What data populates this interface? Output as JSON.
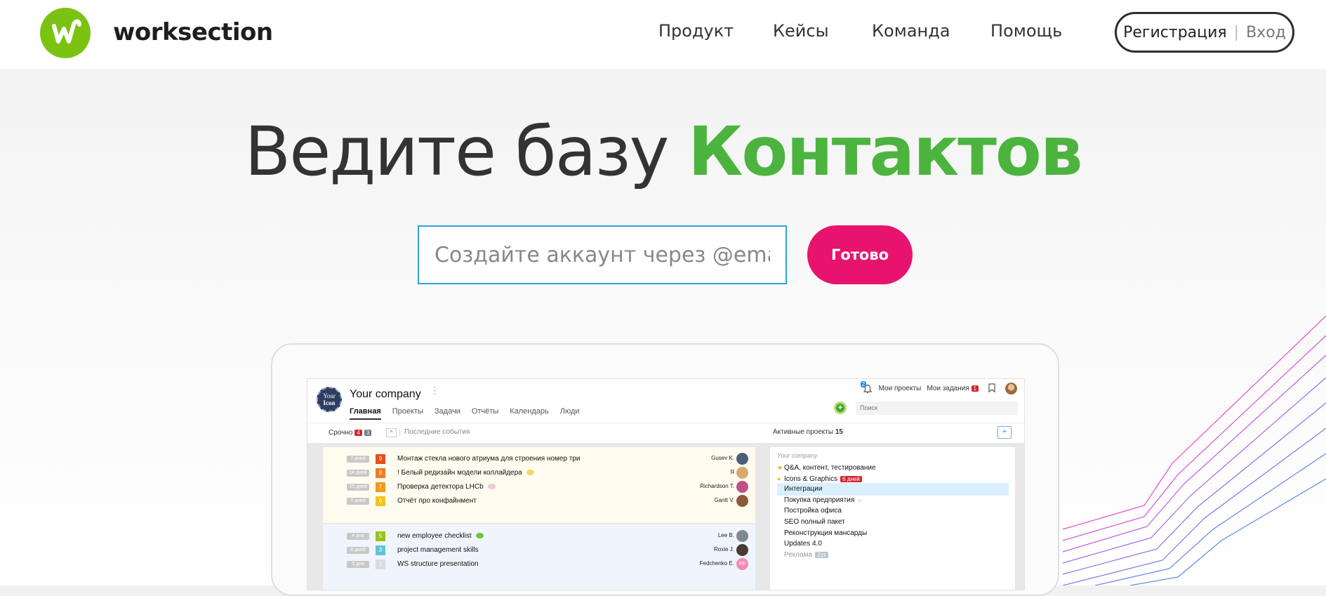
{
  "header": {
    "brand": "worksection",
    "nav": [
      "Продукт",
      "Кейсы",
      "Команда",
      "Помощь"
    ],
    "register": "Регистрация",
    "separator": "|",
    "login": "Вход"
  },
  "hero": {
    "title_plain": "Ведите базу",
    "title_accent": "Контактов",
    "email_placeholder": "Создайте аккаунт через @email",
    "submit_label": "Готово"
  },
  "colors": {
    "brand_green": "#7ac313",
    "accent_green": "#4cb43e",
    "cta_pink": "#e8136f",
    "input_border": "#2ea3d9"
  },
  "app": {
    "logo_text": [
      "Your",
      "Icon"
    ],
    "company": "Your company",
    "tabs": [
      "Главная",
      "Проекты",
      "Задачи",
      "Отчёты",
      "Календарь",
      "Люди"
    ],
    "notifications": "2",
    "my_projects": "Мои проекты",
    "my_tasks": "Мои задания",
    "my_tasks_count": "1",
    "search_placeholder": "Поиск",
    "urgent_label": "Срочно",
    "urgent_count_red": "4",
    "urgent_count_grey": "3",
    "collapse": "^",
    "last_events": "Последние события",
    "active_projects_label": "Активные проекты",
    "active_projects_count": "15",
    "add_project": "+",
    "tasks_urgent": [
      {
        "days": "7 дней",
        "prio": "9",
        "prio_color": "#e84e1b",
        "name": "Монтаж стекла нового атриума для строения номер три",
        "chat": "",
        "assignee": "Gusev K.",
        "avatar_color": "#4a6078"
      },
      {
        "days": "14 дней",
        "prio": "8",
        "prio_color": "#f07c1f",
        "name": "! Белый редизайн модели коллайдера",
        "chat": "#f6d562",
        "assignee": "Я",
        "avatar_color": "#d9a86c"
      },
      {
        "days": "15 дней",
        "prio": "7",
        "prio_color": "#f29a1c",
        "name": "Проверка детектора LHCb",
        "chat": "#f6c5d8",
        "assignee": "Richardson T.",
        "avatar_color": "#c24f8c"
      },
      {
        "days": "9 дней",
        "prio": "6",
        "prio_color": "#f7c21a",
        "name": "Отчёт про конфайнмент",
        "chat": "",
        "assignee": "Gantt V.",
        "avatar_color": "#8a5a3a"
      }
    ],
    "tasks_normal": [
      {
        "days": "4 дня",
        "prio": "5",
        "prio_color": "#98c21d",
        "name": "new employee checklist",
        "chat": "#6fc43d",
        "assignee": "Lee B.",
        "avatar_color": "#7e8a93"
      },
      {
        "days": "6 дней",
        "prio": "3",
        "prio_color": "#62c1d6",
        "name": "project management skills",
        "chat": "",
        "assignee": "Roxie J.",
        "avatar_color": "#4b3b36"
      },
      {
        "days": "3 дня",
        "prio": "1",
        "prio_color": "#d8dde2",
        "name": "WS structure presentation",
        "chat": "",
        "assignee": "Fedchenko E.",
        "avatar_color": "#f38bb4",
        "avatar_text": "FE"
      }
    ],
    "projects_heading": "Your company",
    "projects": [
      {
        "name": "Q&A, контент, тестирование",
        "marker": "★",
        "marker_color": "#f2a51d",
        "badge": "",
        "selected": false
      },
      {
        "name": "Icons & Graphics",
        "marker": "●",
        "marker_color": "#f2c01d",
        "badge": "6 дней",
        "selected": false
      },
      {
        "name": "Интеграции",
        "marker": "",
        "marker_color": "",
        "badge": "",
        "selected": true
      },
      {
        "name": "Покупка предприятия",
        "marker": "",
        "marker_color": "",
        "badge": "",
        "dot": "○",
        "selected": false
      },
      {
        "name": "Постройка офиса",
        "marker": "",
        "marker_color": "",
        "badge": "",
        "selected": false
      },
      {
        "name": "SEO полный пакет",
        "marker": "",
        "marker_color": "",
        "badge": "",
        "selected": false
      },
      {
        "name": "Реконструкция мансарды",
        "marker": "",
        "marker_color": "",
        "badge": "",
        "selected": false
      },
      {
        "name": "Updates 4.0",
        "marker": "",
        "marker_color": "",
        "badge": "",
        "selected": false
      },
      {
        "name": "Реклама",
        "marker": "",
        "marker_color": "",
        "badge_grey": "Zzz",
        "selected": false,
        "muted": true
      }
    ]
  }
}
